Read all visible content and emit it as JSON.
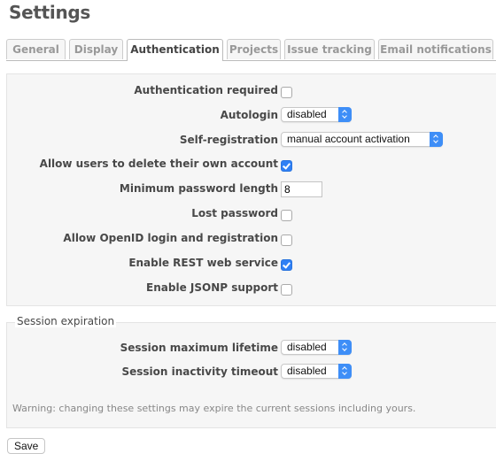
{
  "page": {
    "title": "Settings"
  },
  "tabs": [
    {
      "label": "General",
      "selected": false
    },
    {
      "label": "Display",
      "selected": false
    },
    {
      "label": "Authentication",
      "selected": true
    },
    {
      "label": "Projects",
      "selected": false
    },
    {
      "label": "Issue tracking",
      "selected": false
    },
    {
      "label": "Email notifications",
      "selected": false
    }
  ],
  "auth": {
    "authentication_required": {
      "label": "Authentication required",
      "checked": false
    },
    "autologin": {
      "label": "Autologin",
      "value": "disabled"
    },
    "self_registration": {
      "label": "Self-registration",
      "value": "manual account activation"
    },
    "allow_delete_account": {
      "label": "Allow users to delete their own account",
      "checked": true
    },
    "min_password_length": {
      "label": "Minimum password length",
      "value": "8"
    },
    "lost_password": {
      "label": "Lost password",
      "checked": false
    },
    "openid": {
      "label": "Allow OpenID login and registration",
      "checked": false
    },
    "rest_api": {
      "label": "Enable REST web service",
      "checked": true
    },
    "jsonp": {
      "label": "Enable JSONP support",
      "checked": false
    }
  },
  "session": {
    "legend": "Session expiration",
    "max_lifetime": {
      "label": "Session maximum lifetime",
      "value": "disabled"
    },
    "inactivity_timeout": {
      "label": "Session inactivity timeout",
      "value": "disabled"
    },
    "warning": "Warning: changing these settings may expire the current sessions including yours."
  },
  "actions": {
    "save_label": "Save"
  },
  "colors": {
    "accent": "#3e8ef7",
    "checked": "#2f80f5",
    "panel_bg": "#f6f6f6"
  }
}
